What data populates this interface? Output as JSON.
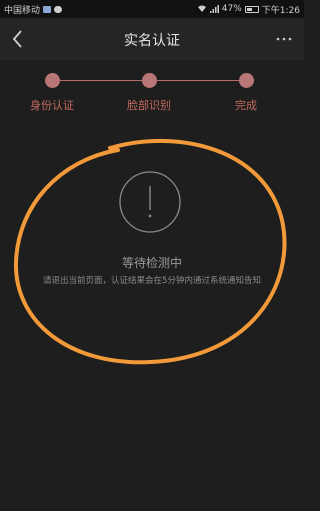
{
  "status_bar": {
    "carrier": "中国移动",
    "battery": "47%",
    "time": "下午1:26",
    "battery_level": 0.47
  },
  "nav": {
    "back_icon": "chevron-left-icon",
    "title": "实名认证",
    "more_icon": "more-dots-icon"
  },
  "steps": [
    {
      "label": "身份认证"
    },
    {
      "label": "脸部识别"
    },
    {
      "label": "完成"
    }
  ],
  "colors": {
    "background": "#1e1e1e",
    "step_accent": "#c46a5e",
    "annotation": "#f29a3a"
  },
  "status": {
    "icon": "exclamation-circle-icon",
    "title": "等待检测中",
    "description": "请退出当前页面，认证结果会在5分钟内通过系统通知告知"
  }
}
